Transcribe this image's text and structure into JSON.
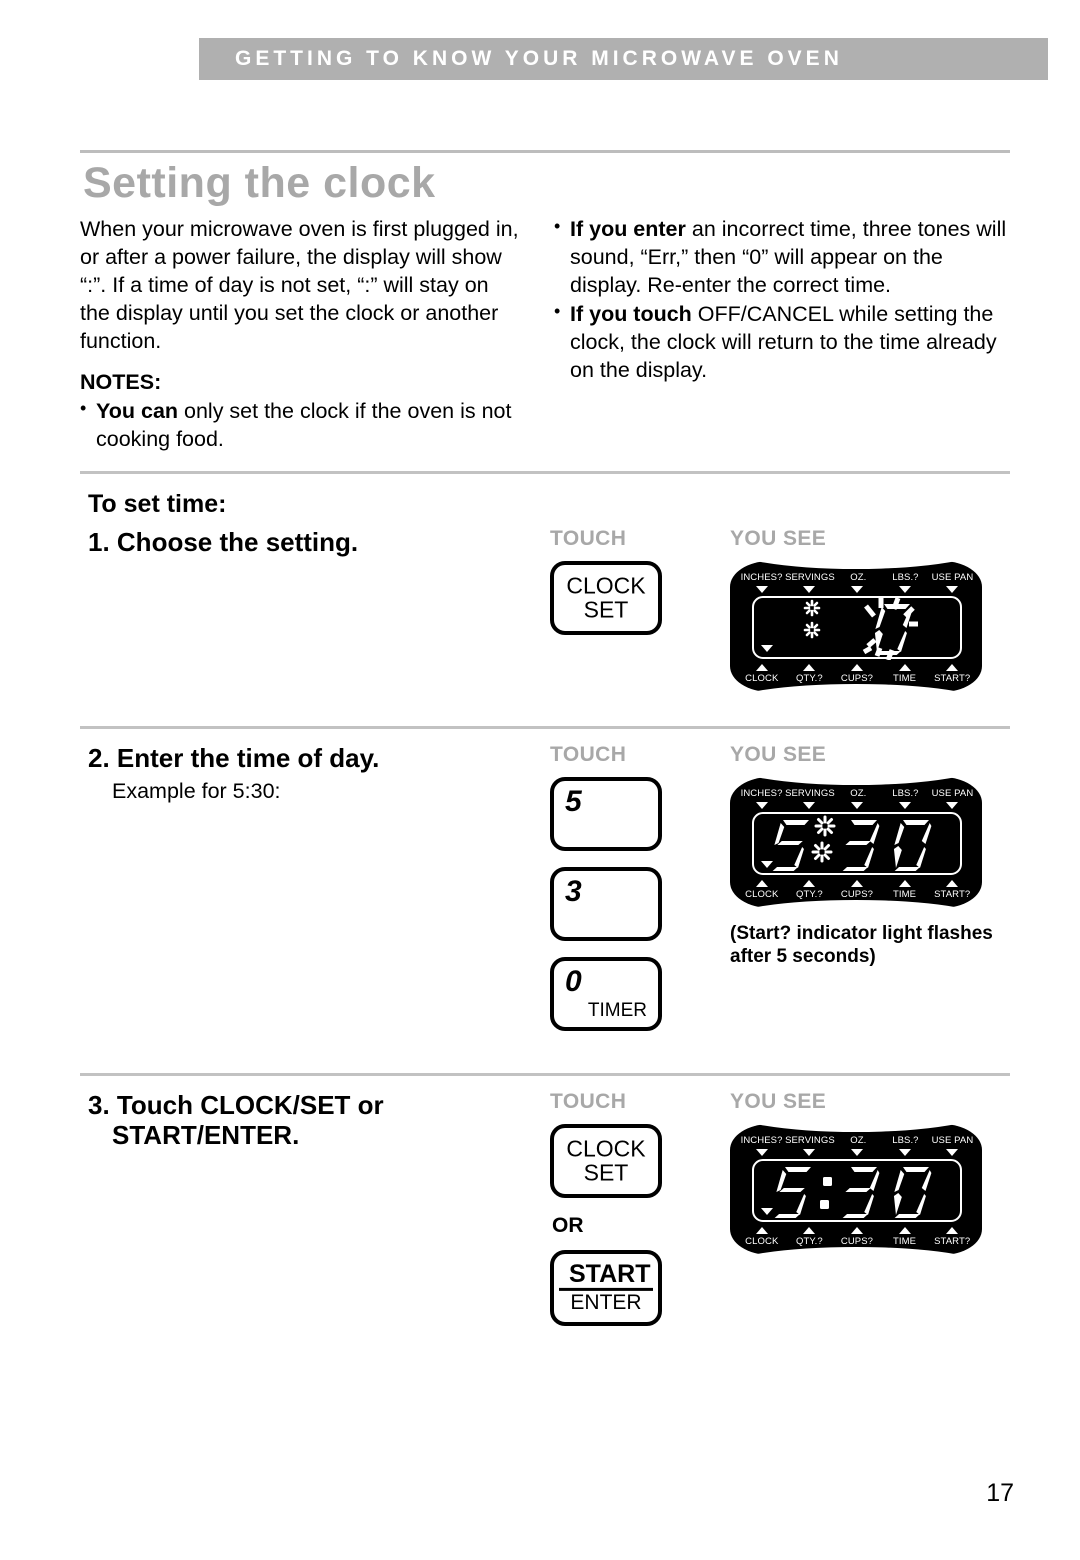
{
  "header": {
    "banner_title": "GETTING TO KNOW YOUR MICROWAVE OVEN",
    "banner_bg": "#b0b0b0"
  },
  "page": {
    "title": "Setting the clock",
    "title_color": "#a8a8a8",
    "number": "17"
  },
  "intro": {
    "paragraph": "When your microwave oven is first plugged in, or after a power failure, the display will show “:”. If a time of day is not set, “:” will stay on the display until you set the clock or another function.",
    "notes_heading": "NOTES:",
    "notes": [
      {
        "bold": "You can",
        "rest": " only set the clock if the oven is not cooking food."
      }
    ],
    "right_bullets": [
      {
        "bold": "If you enter",
        "rest": " an incorrect time, three tones will sound, “Err,” then “0” will appear on the display. Re-enter the correct time."
      },
      {
        "bold": "If you touch",
        "rest": " OFF/CANCEL while setting the clock, the clock will return to the time already on the display."
      }
    ]
  },
  "procedure": {
    "heading": "To set time:",
    "col_touch_label": "TOUCH",
    "col_see_label": "YOU SEE",
    "or_label": "OR"
  },
  "steps": [
    {
      "title": "1. Choose the setting.",
      "subtitle": "",
      "keys": [
        {
          "type": "word",
          "line1": "CLOCK",
          "line2": "SET"
        }
      ],
      "display": {
        "value": "0",
        "mode": "flashing-zero",
        "colon": "none",
        "clock_indicator": true,
        "start_indicator": false
      },
      "caption": ""
    },
    {
      "title": "2. Enter the time of day.",
      "subtitle": "Example for 5:30:",
      "keys": [
        {
          "type": "digit",
          "digit": "5",
          "sub": ""
        },
        {
          "type": "digit",
          "digit": "3",
          "sub": ""
        },
        {
          "type": "digit",
          "digit": "0",
          "sub": "TIMER"
        }
      ],
      "display": {
        "value": "530",
        "mode": "flashing-colon",
        "colon": "flash",
        "clock_indicator": true,
        "start_indicator": true
      },
      "caption": "(Start? indicator light flashes after 5 seconds)"
    },
    {
      "title": "3. Touch CLOCK/SET or START/ENTER.",
      "subtitle": "",
      "keys": [
        {
          "type": "word",
          "line1": "CLOCK",
          "line2": "SET"
        },
        {
          "type": "start",
          "line1": "START",
          "line2": "ENTER"
        }
      ],
      "display": {
        "value": "530",
        "mode": "steady",
        "colon": "solid",
        "clock_indicator": true,
        "start_indicator": false
      },
      "caption": ""
    }
  ],
  "display_panel": {
    "top_labels": [
      "INCHES?",
      "SERVINGS",
      "OZ.",
      "LBS.?",
      "USE PAN"
    ],
    "bottom_labels": [
      "CLOCK",
      "QTY.?",
      "CUPS?",
      "TIME",
      "START?"
    ]
  }
}
